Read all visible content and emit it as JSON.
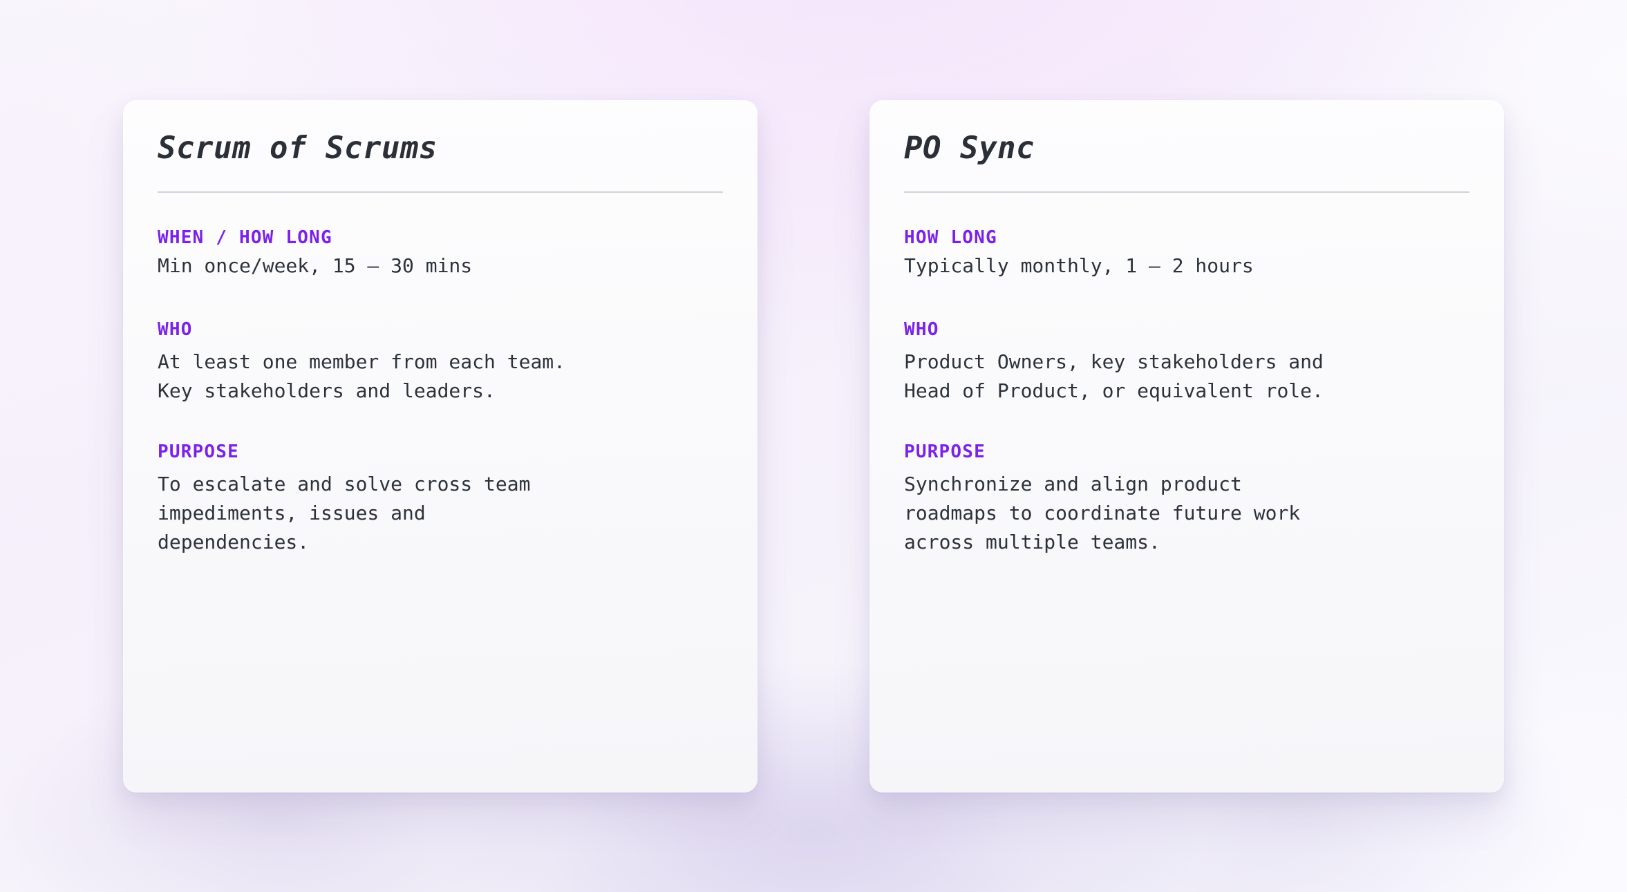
{
  "theme": {
    "accent_color": "#7c22e8",
    "text_color": "#2d323a",
    "title_color": "#2b3038",
    "divider_color": "#d2d2da",
    "card_background": "#fbfbfd",
    "page_background": "#f6f0fb"
  },
  "cards": [
    {
      "title": "Scrum of Scrums",
      "sections": [
        {
          "label": "WHEN / HOW LONG",
          "body": "Min once/week, 15 – 30 mins",
          "tight": true
        },
        {
          "label": "WHO",
          "body": "At least one member from each team.\nKey stakeholders and leaders.",
          "tight": false
        },
        {
          "label": "PURPOSE",
          "body": "To escalate and solve cross team\nimpediments, issues and\ndependencies.",
          "tight": false
        }
      ]
    },
    {
      "title": "PO Sync",
      "sections": [
        {
          "label": "HOW LONG",
          "body": "Typically monthly, 1 – 2 hours",
          "tight": true
        },
        {
          "label": "WHO",
          "body": "Product Owners, key stakeholders and\nHead of Product, or equivalent role.",
          "tight": false
        },
        {
          "label": "PURPOSE",
          "body": "Synchronize and align product\nroadmaps to coordinate future work\nacross multiple teams.",
          "tight": false
        }
      ]
    }
  ]
}
